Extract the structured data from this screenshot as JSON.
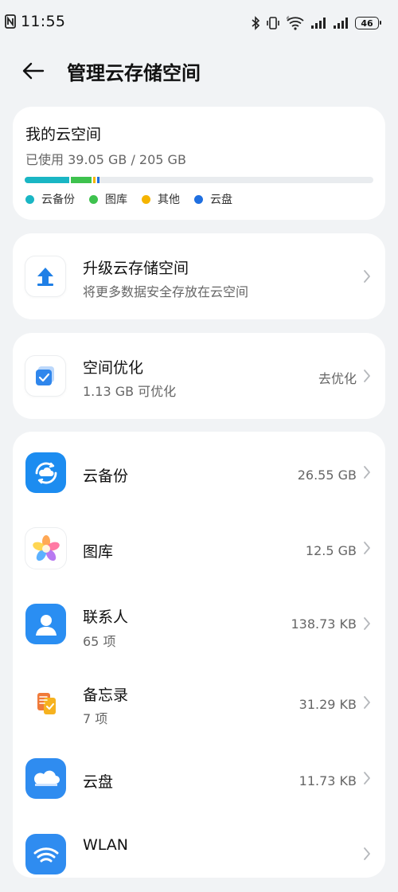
{
  "status_bar": {
    "time": "11:55",
    "battery": "46",
    "icons": [
      "nfc-icon",
      "bluetooth-icon",
      "vibrate-icon",
      "wifi-icon",
      "signal-icon",
      "signal-icon",
      "battery-icon"
    ]
  },
  "header": {
    "title": "管理云存储空间",
    "back_icon": "back-arrow-icon"
  },
  "storage": {
    "title": "我的云空间",
    "used_text": "已使用 39.05 GB / 205 GB",
    "usage_fraction": 0.19,
    "segments": [
      {
        "label": "云备份",
        "color": "#1ab6c4",
        "gb": 26.55
      },
      {
        "label": "图库",
        "color": "#3ec24e",
        "gb": 12.5
      },
      {
        "label": "其他",
        "color": "#f5b400",
        "gb": 0.3
      },
      {
        "label": "云盘",
        "color": "#1f6fe0",
        "gb": 0.25
      }
    ],
    "legend": [
      {
        "label": "云备份",
        "color": "#1ab6c4"
      },
      {
        "label": "图库",
        "color": "#3ec24e"
      },
      {
        "label": "其他",
        "color": "#f5b400"
      },
      {
        "label": "云盘",
        "color": "#1f6fe0"
      }
    ]
  },
  "upgrade": {
    "title": "升级云存储空间",
    "subtitle": "将更多数据安全存放在云空间",
    "icon": "upload-arrow-icon"
  },
  "optimize": {
    "title": "空间优化",
    "subtitle": "1.13 GB 可优化",
    "action": "去优化",
    "icon": "optimize-check-icon"
  },
  "apps": [
    {
      "title": "云备份",
      "subtitle": "",
      "value": "26.55 GB",
      "icon": "cloud-backup-icon"
    },
    {
      "title": "图库",
      "subtitle": "",
      "value": "12.5 GB",
      "icon": "gallery-icon"
    },
    {
      "title": "联系人",
      "subtitle": "65 项",
      "value": "138.73 KB",
      "icon": "contacts-icon"
    },
    {
      "title": "备忘录",
      "subtitle": "7 项",
      "value": "31.29 KB",
      "icon": "notes-icon"
    },
    {
      "title": "云盘",
      "subtitle": "",
      "value": "11.73 KB",
      "icon": "cloud-drive-icon"
    },
    {
      "title": "WLAN",
      "subtitle": "",
      "value": "",
      "icon": "wlan-icon"
    }
  ],
  "colors": {
    "background": "#f1f3f5",
    "card": "#ffffff",
    "accent_blue": "#1f6fe0"
  }
}
